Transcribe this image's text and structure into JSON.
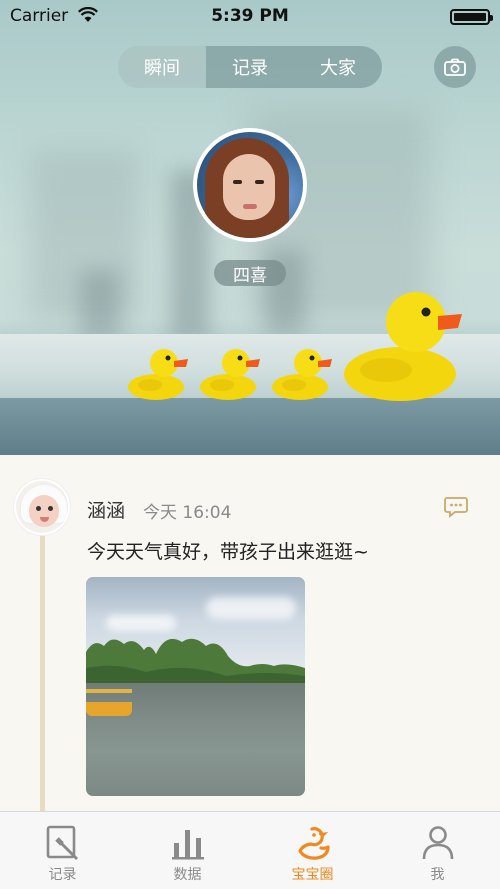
{
  "status_bar": {
    "carrier": "Carrier",
    "time": "5:39 PM"
  },
  "header": {
    "tabs": [
      {
        "label": "瞬间",
        "active": true
      },
      {
        "label": "记录",
        "active": false
      },
      {
        "label": "大家",
        "active": false
      }
    ],
    "camera_icon": "camera-icon"
  },
  "profile": {
    "name": "四喜"
  },
  "post": {
    "author": "涵涵",
    "time": "今天 16:04",
    "text": "今天天气真好，带孩子出来逛逛~",
    "comment_icon": "comment-icon"
  },
  "tabbar": {
    "items": [
      {
        "label": "记录",
        "icon": "edit-icon",
        "active": false
      },
      {
        "label": "数据",
        "icon": "bar-chart-icon",
        "active": false
      },
      {
        "label": "宝宝圈",
        "icon": "duck-icon",
        "active": true
      },
      {
        "label": "我",
        "icon": "person-icon",
        "active": false
      }
    ]
  },
  "colors": {
    "accent": "#f08a1f",
    "inactive": "#8a8a8a",
    "timeline": "#e6dcc2"
  }
}
